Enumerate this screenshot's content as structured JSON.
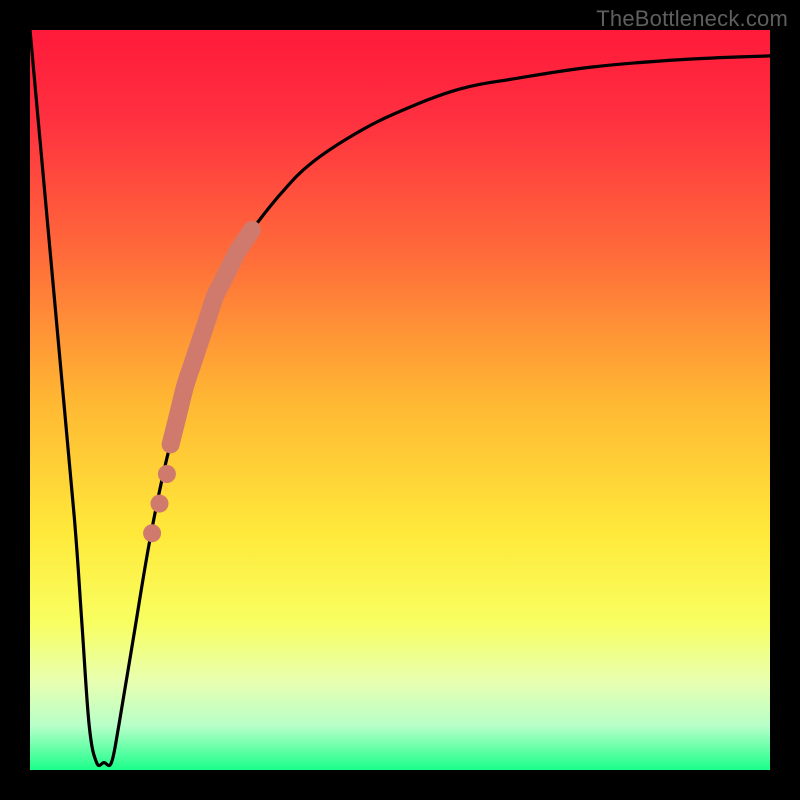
{
  "watermark": "TheBottleneck.com",
  "gradient": {
    "stops": [
      {
        "offset": 0.0,
        "color": "#ff1a3a"
      },
      {
        "offset": 0.12,
        "color": "#ff3040"
      },
      {
        "offset": 0.3,
        "color": "#ff6a3a"
      },
      {
        "offset": 0.5,
        "color": "#ffb733"
      },
      {
        "offset": 0.68,
        "color": "#ffe93a"
      },
      {
        "offset": 0.8,
        "color": "#f8ff60"
      },
      {
        "offset": 0.88,
        "color": "#e8ffb0"
      },
      {
        "offset": 0.94,
        "color": "#b8ffc8"
      },
      {
        "offset": 1.0,
        "color": "#1aff8a"
      }
    ]
  },
  "chart_data": {
    "type": "line",
    "title": "",
    "xlabel": "",
    "ylabel": "",
    "xlim": [
      0,
      100
    ],
    "ylim": [
      0,
      100
    ],
    "series": [
      {
        "name": "curve",
        "x": [
          0,
          2,
          4,
          6,
          7,
          8,
          9,
          10,
          11,
          12,
          14,
          16,
          18,
          20,
          22,
          24,
          26,
          28,
          30,
          34,
          38,
          44,
          50,
          58,
          66,
          76,
          88,
          100
        ],
        "y": [
          100,
          78,
          56,
          34,
          20,
          6,
          1,
          1,
          1,
          6,
          18,
          30,
          40,
          48,
          55,
          61,
          66,
          70,
          73,
          78,
          82,
          86,
          89,
          92,
          93.5,
          95,
          96,
          96.5
        ]
      }
    ],
    "highlight_segment": {
      "note": "thick salmon overlay on rising limb",
      "x": [
        19,
        20,
        21,
        22,
        23,
        24,
        25,
        26,
        27,
        28,
        29,
        30
      ],
      "y": [
        44,
        48,
        52,
        55,
        58,
        61,
        64,
        66,
        68,
        70,
        71.5,
        73
      ],
      "style": "thick"
    },
    "highlight_dots": {
      "x": [
        16.5,
        17.5,
        18.5
      ],
      "y": [
        32,
        36,
        40
      ],
      "r": 9
    },
    "colors": {
      "curve": "#000000",
      "highlight": "#cf7a6c"
    }
  }
}
